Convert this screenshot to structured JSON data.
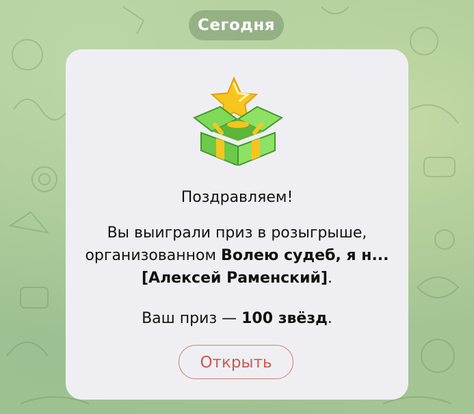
{
  "chat": {
    "date_label": "Сегодня"
  },
  "message": {
    "title": "Поздравляем!",
    "line1": "Вы выиграли приз в розыгрыше,",
    "line2_prefix": "организованном ",
    "line2_bold": "Волею судеб, я н...",
    "line3_bold": "[Алексей Раменский]",
    "line3_suffix": ".",
    "prize_prefix": "Ваш приз — ",
    "prize_bold": "100 звёзд",
    "prize_suffix": ".",
    "open_label": "Открыть",
    "icon": "gift-box-star-icon"
  },
  "colors": {
    "card_bg": "#efeff3",
    "button_accent": "#c85a52",
    "pill_bg": "#7f9a6e"
  }
}
